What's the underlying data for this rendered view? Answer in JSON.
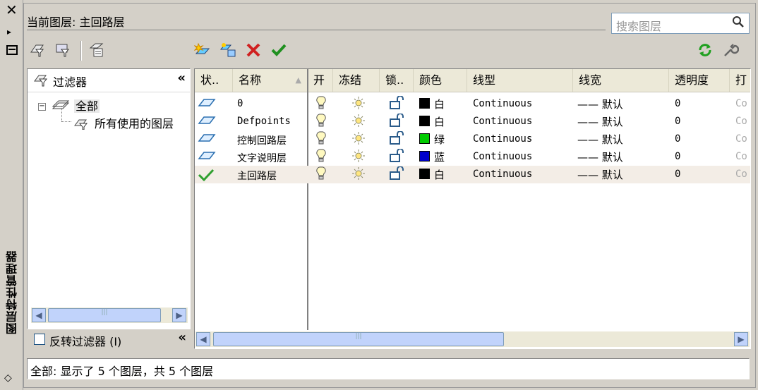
{
  "palette": {
    "window_bg": "#d4d0c8",
    "accent_green": "#00a000",
    "delete_red": "#d02020",
    "selected_row": "#f3ede6"
  },
  "strip": {
    "close_glyph": "✕",
    "vertical_title": "图层特性管理器"
  },
  "header": {
    "current_layer_label": "当前图层: 主回路层",
    "search_placeholder": "搜索图层"
  },
  "toolbar": {
    "left_icons": [
      "new-property-filter-icon",
      "new-group-filter-icon",
      "layer-states-manager-icon"
    ],
    "layer_icons": [
      "new-layer-icon",
      "new-layer-vp-frozen-icon",
      "delete-layer-icon",
      "set-current-icon"
    ],
    "right_icons": [
      "refresh-icon",
      "settings-icon"
    ]
  },
  "tree": {
    "header_label": "过滤器",
    "collapse_glyph": "«",
    "items": [
      {
        "label": "全部",
        "expander": "⊟"
      },
      {
        "label": "所有使用的图层"
      }
    ],
    "invert_label": "反转过滤器 (I)"
  },
  "grid": {
    "columns": [
      "状..",
      "名称",
      "开",
      "冻结",
      "锁..",
      "颜色",
      "线型",
      "线宽",
      "透明度",
      "打"
    ],
    "sort_indicator": "▲",
    "rows": [
      {
        "status": "parallelogram",
        "name": "0",
        "color_name": "白",
        "color_hex": "#000000",
        "linetype": "Continuous",
        "lineweight": "—— 默认",
        "transparency": "0",
        "plot": "Co"
      },
      {
        "status": "parallelogram",
        "name": "Defpoints",
        "color_name": "白",
        "color_hex": "#000000",
        "linetype": "Continuous",
        "lineweight": "—— 默认",
        "transparency": "0",
        "plot": "Co"
      },
      {
        "status": "parallelogram",
        "name": "控制回路层",
        "color_name": "绿",
        "color_hex": "#00cc00",
        "linetype": "Continuous",
        "lineweight": "—— 默认",
        "transparency": "0",
        "plot": "Co"
      },
      {
        "status": "parallelogram",
        "name": "文字说明层",
        "color_name": "蓝",
        "color_hex": "#0000cc",
        "linetype": "Continuous",
        "lineweight": "—— 默认",
        "transparency": "0",
        "plot": "Co"
      },
      {
        "status": "current",
        "name": "主回路层",
        "color_name": "白",
        "color_hex": "#000000",
        "linetype": "Continuous",
        "lineweight": "—— 默认",
        "transparency": "0",
        "plot": "Co"
      }
    ]
  },
  "status": {
    "text": "全部: 显示了 5 个图层，共 5 个图层"
  }
}
